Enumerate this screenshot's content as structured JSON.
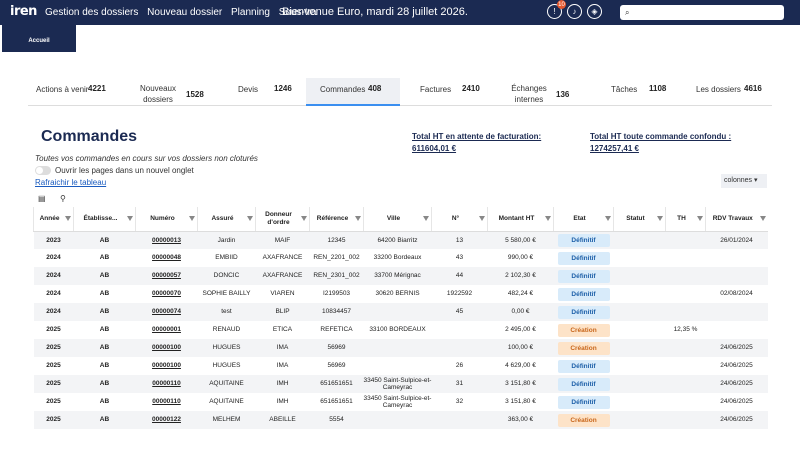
{
  "topbar": {
    "logo": "iren",
    "nav": [
      "Gestion des dossiers",
      "Nouveau dossier",
      "Planning",
      "Sous-tra"
    ],
    "welcome": "Bienvenue Euro, mardi 28 juillet 2026.",
    "notif_badge": "10",
    "search_icon": "search-icon"
  },
  "accueil": "Accueil",
  "tabs": [
    {
      "label": "Actions à venir",
      "count": "4221"
    },
    {
      "label": "Nouveaux dossiers",
      "count": "1528"
    },
    {
      "label": "Devis",
      "count": "1246"
    },
    {
      "label": "Commandes",
      "count": "408"
    },
    {
      "label": "Factures",
      "count": "2410"
    },
    {
      "label": "Échanges internes",
      "count": "136"
    },
    {
      "label": "Tâches",
      "count": "1108"
    },
    {
      "label": "Les dossiers",
      "count": "4616"
    }
  ],
  "page": {
    "title": "Commandes",
    "subtitle": "Toutes vos commandes en cours sur vos dossiers non cloturés",
    "toggle_label": "Ouvrir les pages dans un nouvel onglet",
    "refresh": "Rafraichir le tableau",
    "total1_label": "Total HT en attente de facturation:",
    "total1_value": "611604,01 €",
    "total2_label": "Total HT toute commande confondu :",
    "total2_value": "1274257,41 €",
    "colonnes": "colonnes"
  },
  "table": {
    "headers": [
      "Année",
      "Établisse...",
      "Numéro",
      "Assuré",
      "Donneur d'ordre",
      "Référence",
      "Ville",
      "N°",
      "Montant HT",
      "Etat",
      "Statut",
      "TH",
      "RDV Travaux"
    ],
    "rows": [
      [
        "2023",
        "AB",
        "00000013",
        "Jardin",
        "MAIF",
        "12345",
        "64200 Biarritz",
        "13",
        "5 580,00 €",
        "Définitif",
        "",
        "",
        "26/01/2024"
      ],
      [
        "2024",
        "AB",
        "00000048",
        "EMBIID",
        "AXAFRANCE",
        "REN_2201_002",
        "33200 Bordeaux",
        "43",
        "990,00 €",
        "Définitif",
        "",
        "",
        ""
      ],
      [
        "2024",
        "AB",
        "00000057",
        "DONCIC",
        "AXAFRANCE",
        "REN_2301_002",
        "33700 Mérignac",
        "44",
        "2 102,30 €",
        "Définitif",
        "",
        "",
        ""
      ],
      [
        "2024",
        "AB",
        "00000070",
        "SOPHIE BAILLY",
        "VIAREN",
        "I2199503",
        "30620 BERNIS",
        "1922592",
        "482,24 €",
        "Définitif",
        "",
        "",
        "02/08/2024"
      ],
      [
        "2024",
        "AB",
        "00000074",
        "test",
        "BLIP",
        "10834457",
        "",
        "45",
        "0,00 €",
        "Définitif",
        "",
        "",
        ""
      ],
      [
        "2025",
        "AB",
        "00000001",
        "RENAUD",
        "ETICA",
        "REFETICA",
        "33100 BORDEAUX",
        "",
        "2 495,00 €",
        "Création",
        "",
        "12,35 %",
        ""
      ],
      [
        "2025",
        "AB",
        "00000100",
        "HUGUES",
        "IMA",
        "56969",
        "",
        "",
        "100,00 €",
        "Création",
        "",
        "",
        "24/06/2025"
      ],
      [
        "2025",
        "AB",
        "00000100",
        "HUGUES",
        "IMA",
        "56969",
        "",
        "26",
        "4 629,00 €",
        "Définitif",
        "",
        "",
        "24/06/2025"
      ],
      [
        "2025",
        "AB",
        "00000110",
        "AQUITAINE",
        "IMH",
        "651651651",
        "33450 Saint-Sulpice-et-Cameyrac",
        "31",
        "3 151,80 €",
        "Définitif",
        "",
        "",
        "24/06/2025"
      ],
      [
        "2025",
        "AB",
        "00000110",
        "AQUITAINE",
        "IMH",
        "651651651",
        "33450 Saint-Sulpice-et-Cameyrac",
        "32",
        "3 151,80 €",
        "Définitif",
        "",
        "",
        "24/06/2025"
      ],
      [
        "2025",
        "AB",
        "00000122",
        "MELHEM",
        "ABEILLE",
        "5554",
        "",
        "",
        "363,00 €",
        "Création",
        "",
        "",
        "24/06/2025"
      ]
    ]
  },
  "colors": {
    "navy": "#1b2a52",
    "accent": "#3b8ff0",
    "definitif": "#d8ebfa",
    "creation": "#fde3c8"
  }
}
